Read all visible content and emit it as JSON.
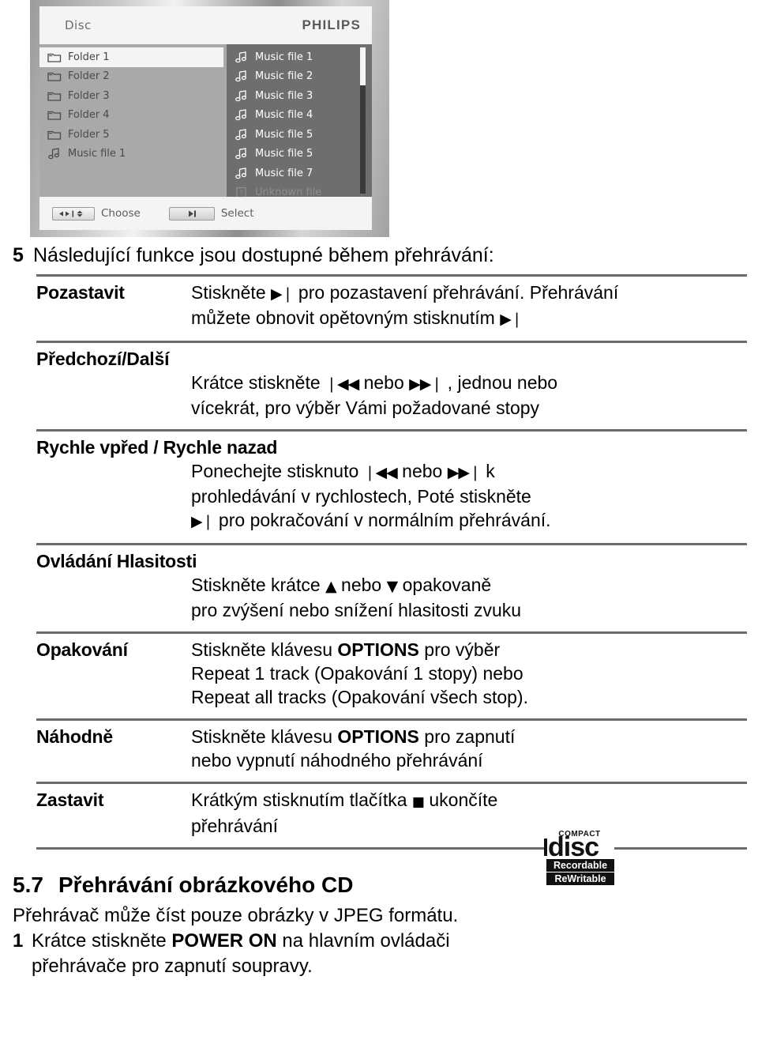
{
  "osd": {
    "title": "Disc",
    "brand": "PHILIPS",
    "left_items": [
      {
        "label": "Folder 1",
        "icon": "folder-icon",
        "selected": true
      },
      {
        "label": "Folder 2",
        "icon": "folder-icon",
        "selected": false
      },
      {
        "label": "Folder 3",
        "icon": "folder-icon",
        "selected": false
      },
      {
        "label": "Folder 4",
        "icon": "folder-icon",
        "selected": false
      },
      {
        "label": "Folder 5",
        "icon": "folder-icon",
        "selected": false
      },
      {
        "label": "Music file 1",
        "icon": "music-note-icon",
        "selected": false
      }
    ],
    "right_items": [
      {
        "label": "Music file 1",
        "icon": "music-note-icon",
        "dim": false
      },
      {
        "label": "Music file 2",
        "icon": "music-note-icon",
        "dim": false
      },
      {
        "label": "Music file 3",
        "icon": "music-note-icon",
        "dim": false
      },
      {
        "label": "Music file 4",
        "icon": "music-note-icon",
        "dim": false
      },
      {
        "label": "Music file 5",
        "icon": "music-note-icon",
        "dim": false
      },
      {
        "label": "Music file 5",
        "icon": "music-note-icon",
        "dim": false
      },
      {
        "label": "Music file 7",
        "icon": "music-note-icon",
        "dim": false
      },
      {
        "label": "Unknown file",
        "icon": "unknown-file-icon",
        "dim": true
      }
    ],
    "footer": {
      "choose_label": "Choose",
      "select_label": "Select",
      "choose_key_glyph": "◂▸ | ↕",
      "select_key_glyph": "▶❘"
    }
  },
  "intro": {
    "number": "5",
    "text": "Následující funkce jsou dostupné během přehrávání:"
  },
  "functions": [
    {
      "label": "Pozastavit",
      "label_full_width": false,
      "desc_indented": false,
      "lines": [
        "Stiskněte ▶❘ pro pozastavení přehrávání. Přehrávání",
        "můžete obnovit opětovným stisknutím ▶❘"
      ]
    },
    {
      "label": "Předchozí/Další",
      "label_full_width": true,
      "desc_indented": true,
      "lines": [
        "Krátce stiskněte ❘◀◀ nebo ▶▶❘ , jednou nebo",
        "vícekrát, pro výběr Vámi požadované stopy"
      ]
    },
    {
      "label": "Rychle vpřed / Rychle nazad",
      "label_full_width": true,
      "desc_indented": true,
      "lines": [
        "Ponechejte stisknuto ❘◀◀ nebo ▶▶❘ k",
        "prohledávání v rychlostech, Poté stiskněte",
        "▶❘ pro pokračování v normálním přehrávání."
      ]
    },
    {
      "label": "Ovládání Hlasitosti",
      "label_full_width": true,
      "desc_indented": true,
      "lines": [
        "Stiskněte krátce ▲ nebo ▼ opakovaně",
        "pro zvýšení nebo snížení hlasitosti zvuku"
      ]
    },
    {
      "label": "Opakování",
      "label_full_width": false,
      "desc_indented": false,
      "lines": [
        "Stiskněte klávesu OPTIONS pro výběr",
        "Repeat 1 track (Opakování 1 stopy) nebo",
        "Repeat all tracks (Opakování všech stop)."
      ]
    },
    {
      "label": "Náhodně",
      "label_full_width": false,
      "desc_indented": false,
      "lines": [
        "Stiskněte klávesu OPTIONS pro zapnutí",
        "nebo vypnutí náhodného přehrávání"
      ]
    },
    {
      "label": "Zastavit",
      "label_full_width": false,
      "desc_indented": false,
      "lines": [
        "Krátkým stisknutím tlačítka ■ ukončíte",
        "přehrávání"
      ]
    }
  ],
  "section": {
    "number": "5.7",
    "title": "Přehrávání obrázkového CD",
    "intro": "Přehrávač může číst pouze obrázky v JPEG formátu.",
    "step_number": "1",
    "step_text": "Krátce stiskněte POWER ON na hlavním ovládači",
    "step_cont": "přehrávače pro zapnutí soupravy."
  },
  "cd_logo": {
    "compact": "COMPACT",
    "disc": "disc",
    "recordable": "Recordable",
    "rewritable": "ReWritable"
  },
  "colors": {
    "page_bg": "#ffffff",
    "text": "#000000",
    "rule": "#6b6b6b",
    "osd_left_pane": "#a9a9a9",
    "osd_right_pane": "#6e6e6e",
    "osd_chrome": "#f4f4f4",
    "osd_brand": "#5a5a5a"
  }
}
